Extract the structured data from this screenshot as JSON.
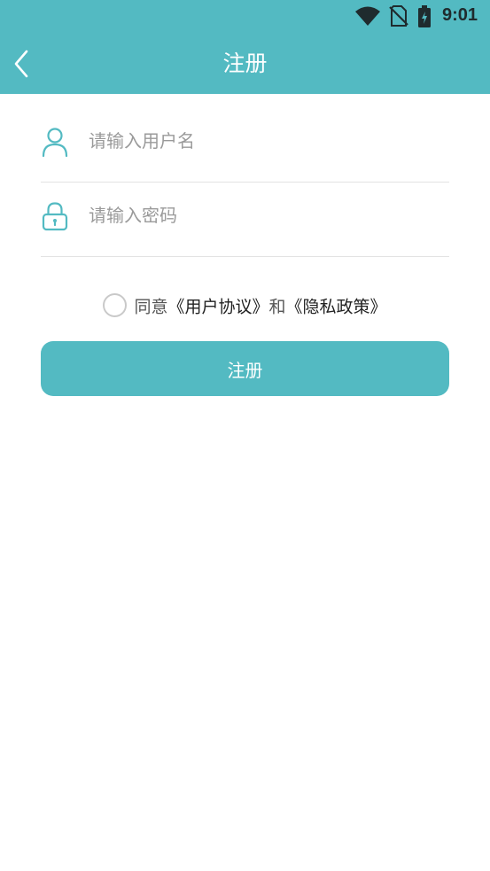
{
  "status_bar": {
    "time": "9:01",
    "icons": [
      "wifi-icon",
      "no-sim-icon",
      "battery-charging-icon"
    ]
  },
  "header": {
    "title": "注册",
    "back_icon": "chevron-left-icon",
    "background_color": "#53BAC2"
  },
  "form": {
    "username": {
      "icon": "user-icon",
      "value": "",
      "placeholder": "请输入用户名"
    },
    "password": {
      "icon": "lock-icon",
      "value": "",
      "placeholder": "请输入密码"
    }
  },
  "agreement": {
    "checked": false,
    "prefix": "同意",
    "user_agreement": "《用户协议》",
    "conjunction": "和",
    "privacy_policy": "《隐私政策》"
  },
  "submit": {
    "label": "注册",
    "color": "#53BAC2"
  }
}
